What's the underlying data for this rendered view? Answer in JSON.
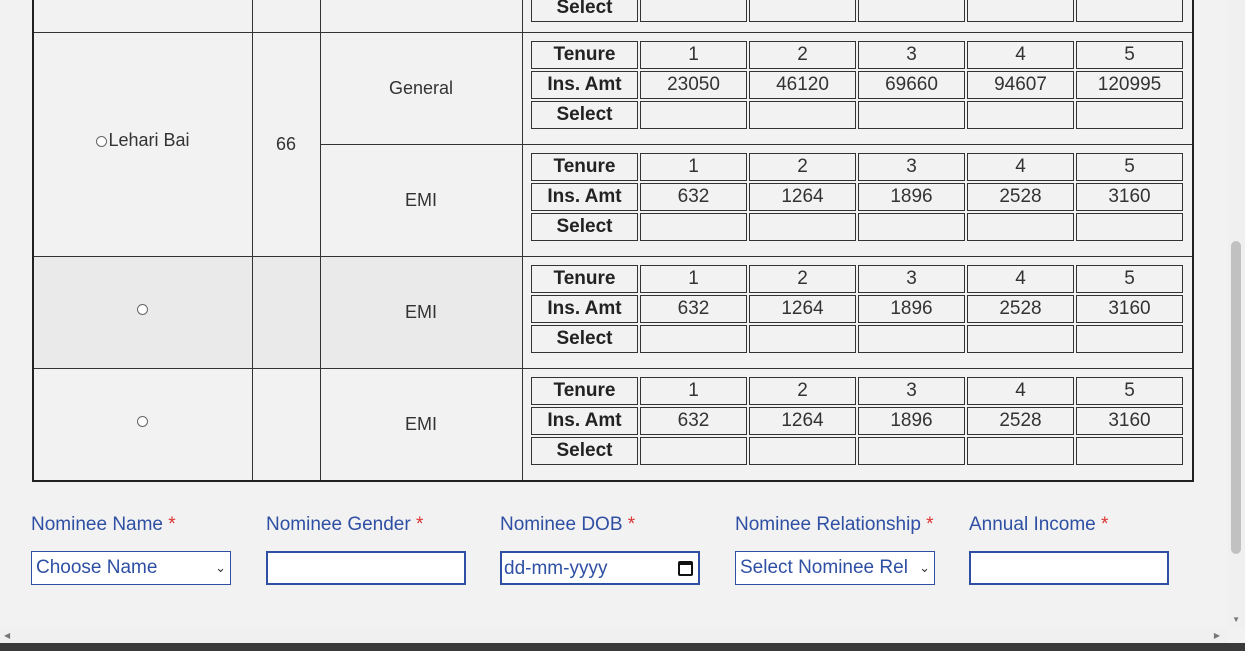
{
  "tenure_table": {
    "headers": [
      "Tenure",
      "Ins. Amt",
      "Select"
    ],
    "tenures": [
      "1",
      "2",
      "3",
      "4",
      "5"
    ]
  },
  "rows": [
    {
      "name": "",
      "age": "",
      "sections": [
        {
          "type": "",
          "amounts": [
            "",
            "",
            "",
            "",
            ""
          ]
        }
      ]
    },
    {
      "name": "Lehari Bai",
      "age": "66",
      "sections": [
        {
          "type": "General",
          "amounts": [
            "23050",
            "46120",
            "69660",
            "94607",
            "120995"
          ]
        },
        {
          "type": "EMI",
          "amounts": [
            "632",
            "1264",
            "1896",
            "2528",
            "3160"
          ]
        }
      ]
    },
    {
      "name": "",
      "age": "",
      "sections": [
        {
          "type": "EMI",
          "amounts": [
            "632",
            "1264",
            "1896",
            "2528",
            "3160"
          ]
        }
      ]
    },
    {
      "name": "",
      "age": "",
      "sections": [
        {
          "type": "EMI",
          "amounts": [
            "632",
            "1264",
            "1896",
            "2528",
            "3160"
          ]
        }
      ]
    }
  ],
  "form": {
    "nominee_name": {
      "label": "Nominee Name",
      "value": "Choose Name"
    },
    "nominee_gender": {
      "label": "Nominee Gender",
      "value": ""
    },
    "nominee_dob": {
      "label": "Nominee DOB",
      "placeholder": "dd-mm-yyyy"
    },
    "nominee_relationship": {
      "label": "Nominee Relationship",
      "value": "Select Nominee Rel"
    },
    "annual_income": {
      "label": "Annual Income",
      "value": ""
    },
    "required_mark": "*"
  },
  "icons": {
    "radio": "radio-button",
    "chevron": "chevron-down-icon",
    "calendar": "calendar-icon"
  },
  "colors": {
    "label_blue": "#2e4fa3",
    "required_red": "#d33333"
  }
}
